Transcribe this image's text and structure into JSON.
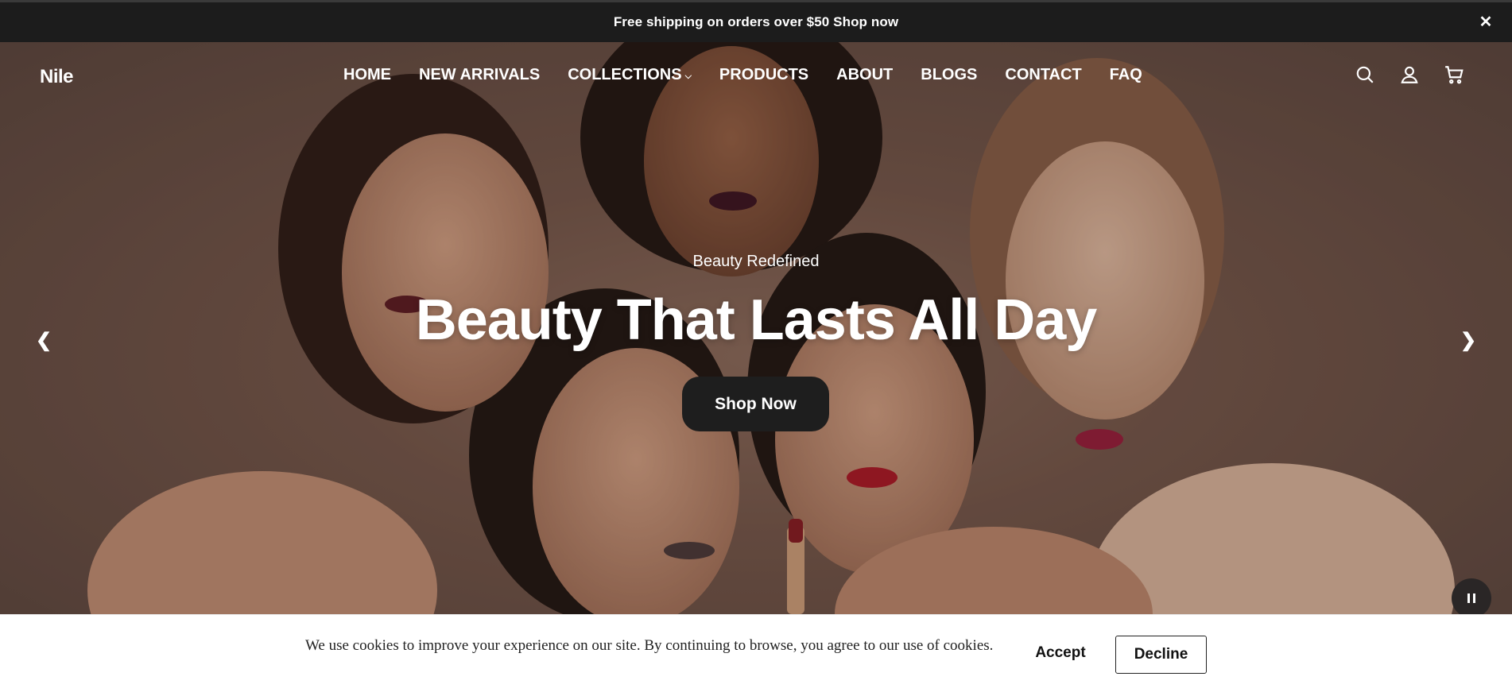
{
  "announcement": {
    "text": "Free shipping on orders over $50 Shop now",
    "close_icon": "close-icon"
  },
  "header": {
    "logo": "Nile",
    "nav": [
      {
        "label": "HOME"
      },
      {
        "label": "NEW ARRIVALS"
      },
      {
        "label": "COLLECTIONS",
        "has_dropdown": true
      },
      {
        "label": "PRODUCTS"
      },
      {
        "label": "ABOUT"
      },
      {
        "label": "BLOGS"
      },
      {
        "label": "CONTACT"
      },
      {
        "label": "FAQ"
      }
    ],
    "icons": [
      "search-icon",
      "account-icon",
      "cart-icon"
    ]
  },
  "hero": {
    "eyebrow": "Beauty Redefined",
    "headline": "Beauty That Lasts All Day",
    "cta": "Shop Now",
    "prev_arrow": "❮",
    "next_arrow": "❯"
  },
  "cookie": {
    "text": "We use cookies to improve your experience on our site. By continuing to browse, you agree to our use of cookies.",
    "accept": "Accept",
    "decline": "Decline"
  },
  "colors": {
    "announcement_bg": "#1c1c1c",
    "cta_bg": "#1e1e1e",
    "hero_bg": "#76594c",
    "cookie_bg": "#ffffff"
  }
}
